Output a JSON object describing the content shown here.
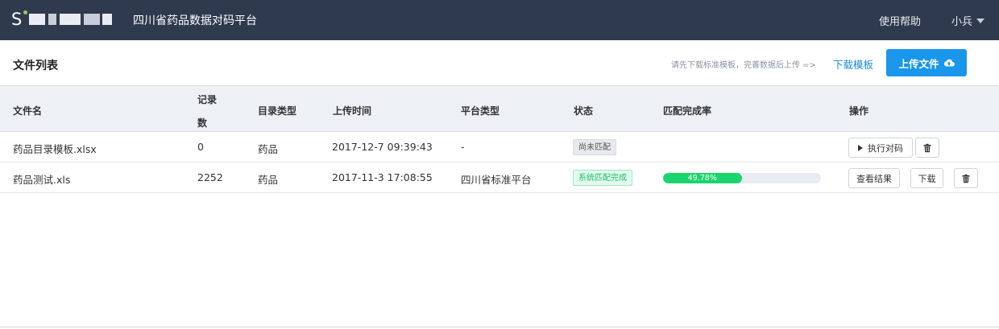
{
  "header": {
    "logo_letter": "S",
    "app_title": "四川省药品数据对码平台",
    "help_label": "使用帮助",
    "user_name": "小兵",
    "icons": {
      "user_menu": "caret-down-icon"
    }
  },
  "toolbar": {
    "page_title": "文件列表",
    "hint": "请先下载标准模板，完善数据后上传 =>",
    "download_template_label": "下载模板",
    "upload_label": "上传文件",
    "upload_icon": "cloud-upload-icon"
  },
  "table": {
    "columns": {
      "file_name": "文件名",
      "record_count_line1": "记录",
      "record_count_line2": "数",
      "catalog_type": "目录类型",
      "upload_time": "上传时间",
      "platform_type": "平台类型",
      "status": "状态",
      "match_rate": "匹配完成率",
      "actions": "操作"
    },
    "rows": [
      {
        "file_name": "药品目录模板.xlsx",
        "record_count": "0",
        "catalog_type": "药品",
        "upload_time": "2017-12-7 09:39:43",
        "platform_type": "-",
        "status": "尚未匹配",
        "actions": {
          "run_label": "执行对码",
          "run_icon": "play-icon",
          "delete_icon": "trash-icon"
        }
      },
      {
        "file_name": "药品测试.xls",
        "record_count": "2252",
        "catalog_type": "药品",
        "upload_time": "2017-11-3 17:08:55",
        "platform_type": "四川省标准平台",
        "status": "系统匹配完成",
        "progress_percent": 49.78,
        "progress_label": "49.78%",
        "actions": {
          "view_label": "查看结果",
          "download_label": "下载",
          "delete_icon": "trash-icon"
        }
      }
    ]
  },
  "colors": {
    "header_bg": "#2f3a4f",
    "primary": "#1a96ea",
    "link": "#1a8bd8",
    "success": "#1ad46e"
  }
}
